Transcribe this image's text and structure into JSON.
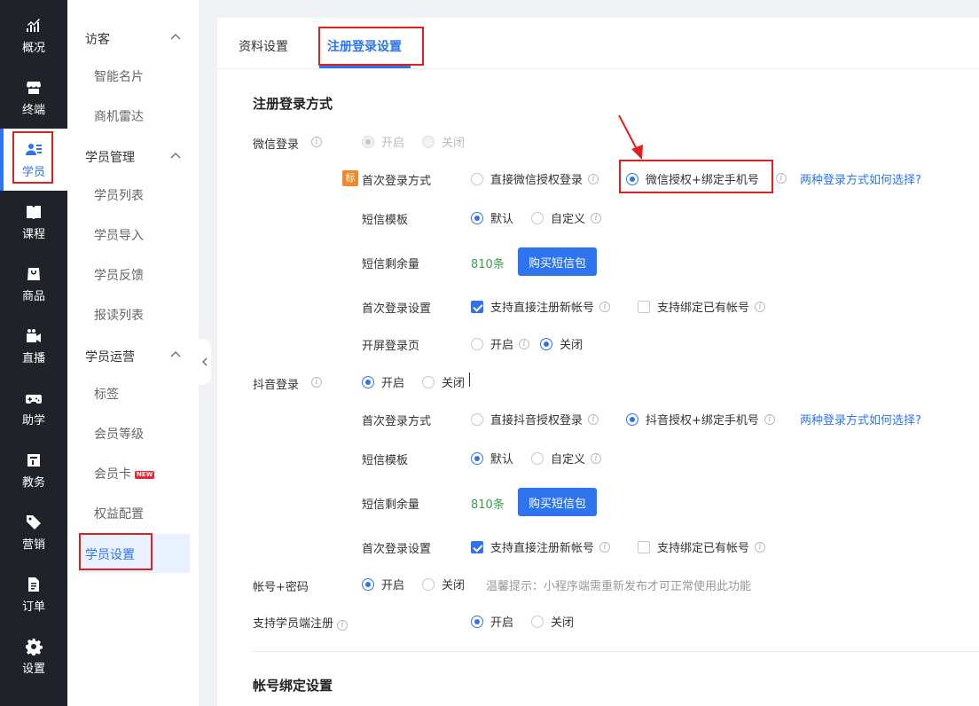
{
  "nav": {
    "items": [
      {
        "label": "概况",
        "icon": "chart-trend-icon"
      },
      {
        "label": "终端",
        "icon": "store-icon"
      },
      {
        "label": "学员",
        "icon": "users-icon"
      },
      {
        "label": "课程",
        "icon": "book-icon"
      },
      {
        "label": "商品",
        "icon": "bag-icon"
      },
      {
        "label": "直播",
        "icon": "video-camera-icon"
      },
      {
        "label": "助学",
        "icon": "gamepad-icon"
      },
      {
        "label": "教务",
        "icon": "calendar-icon"
      },
      {
        "label": "营销",
        "icon": "tag-icon"
      },
      {
        "label": "订单",
        "icon": "document-icon"
      },
      {
        "label": "设置",
        "icon": "gear-icon"
      }
    ],
    "active_index": 2
  },
  "subnav": {
    "groups": [
      {
        "title": "访客",
        "items": [
          "智能名片",
          "商机雷达"
        ]
      },
      {
        "title": "学员管理",
        "items": [
          "学员列表",
          "学员导入",
          "学员反馈",
          "报读列表"
        ]
      },
      {
        "title": "学员运营",
        "items": [
          "标签",
          "会员等级",
          "会员卡",
          "权益配置",
          "学员设置"
        ]
      }
    ],
    "new_badge": "NEW",
    "active_item": "学员设置"
  },
  "tabs": [
    {
      "label": "资料设置",
      "active": false
    },
    {
      "label": "注册登录设置",
      "active": true
    }
  ],
  "section1": {
    "title": "注册登录方式",
    "wechat": {
      "label": "微信登录",
      "on_label": "开启",
      "off_label": "关闭",
      "badge": "标",
      "first_login_label": "首次登录方式",
      "first_login_opt1": "直接微信授权登录",
      "first_login_opt2": "微信授权+绑定手机号",
      "help_link": "两种登录方式如何选择?",
      "sms_template_label": "短信模板",
      "sms_default": "默认",
      "sms_custom": "自定义",
      "sms_balance_label": "短信剩余量",
      "sms_balance_value": "810条",
      "buy_button": "购买短信包",
      "first_setting_label": "首次登录设置",
      "first_setting_opt1": "支持直接注册新帐号",
      "first_setting_opt2": "支持绑定已有帐号",
      "splash_label": "开屏登录页",
      "splash_on": "开启",
      "splash_off": "关闭"
    },
    "douyin": {
      "label": "抖音登录",
      "on_label": "开启",
      "off_label": "关闭",
      "first_login_label": "首次登录方式",
      "first_login_opt1": "直接抖音授权登录",
      "first_login_opt2": "抖音授权+绑定手机号",
      "help_link": "两种登录方式如何选择?",
      "sms_template_label": "短信模板",
      "sms_default": "默认",
      "sms_custom": "自定义",
      "sms_balance_label": "短信剩余量",
      "sms_balance_value": "810条",
      "buy_button": "购买短信包",
      "first_setting_label": "首次登录设置",
      "first_setting_opt1": "支持直接注册新帐号",
      "first_setting_opt2": "支持绑定已有帐号"
    },
    "account": {
      "label": "帐号+密码",
      "on_label": "开启",
      "off_label": "关闭",
      "hint": "温馨提示：小程序端需重新发布才可正常使用此功能",
      "register_label": "支持学员端注册",
      "register_on": "开启",
      "register_off": "关闭"
    }
  },
  "section2": {
    "title": "帐号绑定设置"
  },
  "colors": {
    "accent": "#2e74ee",
    "nav_bg": "#1f2329",
    "highlight_box": "#e02020",
    "balance_green": "#3aa14b",
    "badge_orange": "#f0892b"
  }
}
